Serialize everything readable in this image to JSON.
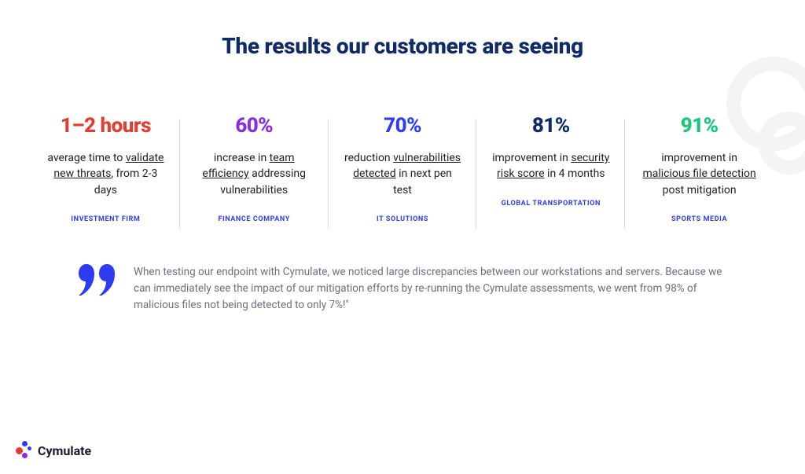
{
  "title": "The results our customers are seeing",
  "stats": [
    {
      "value": "1–2 hours",
      "desc_pre": "average time to ",
      "desc_u": "validate new threats",
      "desc_post": ", from 2-3 days",
      "source": "INVESTMENT FIRM"
    },
    {
      "value": "60%",
      "desc_pre": "increase in ",
      "desc_u": "team efficiency",
      "desc_post": " addressing vulnerabilities",
      "source": "FINANCE COMPANY"
    },
    {
      "value": "70%",
      "desc_pre": "reduction ",
      "desc_u": "vulnerabilities detected",
      "desc_post": " in next pen test",
      "source": "IT SOLUTIONS"
    },
    {
      "value": "81%",
      "desc_pre": "improvement in ",
      "desc_u": "security risk score",
      "desc_post": " in 4 months",
      "source": "GLOBAL TRANSPORTATION"
    },
    {
      "value": "91%",
      "desc_pre": "improvement in ",
      "desc_u": "malicious file detection",
      "desc_post": " post mitigation",
      "source": "SPORTS MEDIA"
    }
  ],
  "quote": "When testing our endpoint with Cymulate, we noticed large discrepancies between our workstations and servers. Because we can immediately see the impact of our mitigation efforts by re-running the Cymulate assessments, we went from 98% of malicious files not being detected to only 7%!\"",
  "logo_text": "Cymulate"
}
